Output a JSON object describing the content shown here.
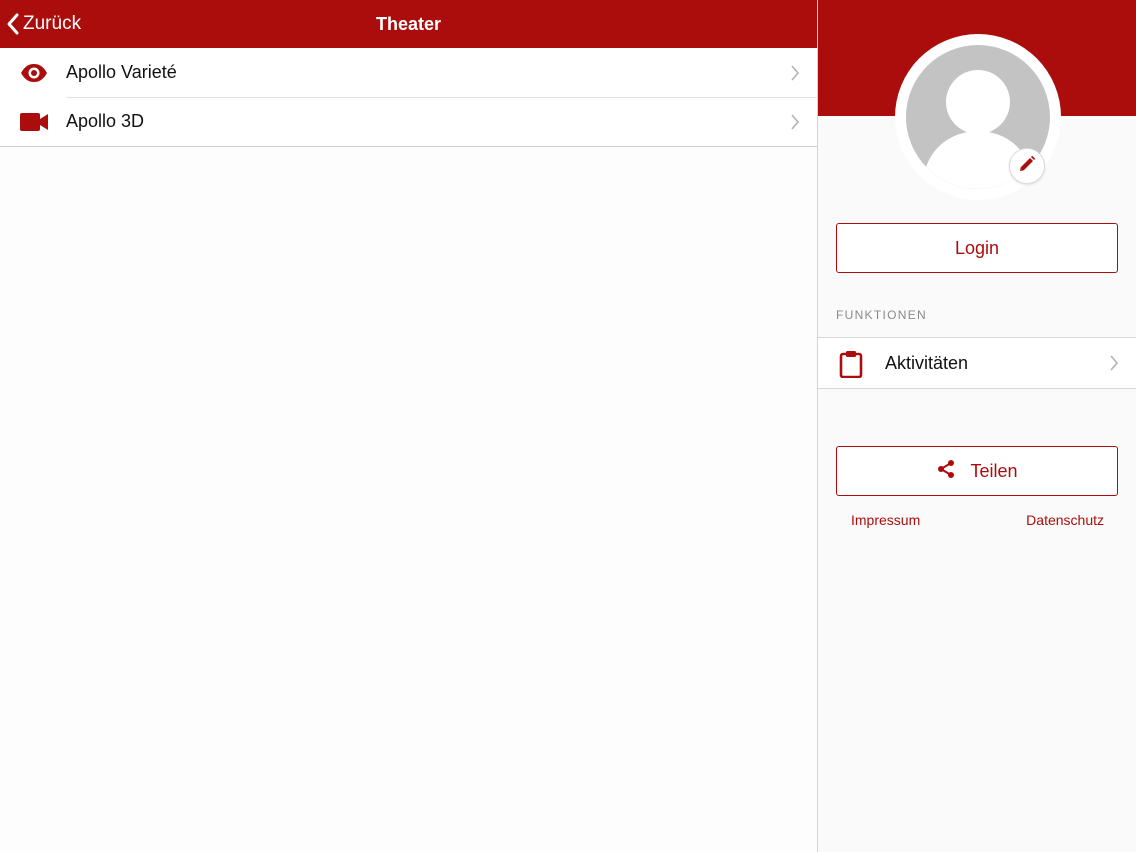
{
  "colors": {
    "accent": "#ab0c0c",
    "background": "#fdfdfd"
  },
  "navbar": {
    "back_label": "Zurück",
    "back_icon": "chevron-left-icon",
    "title": "Theater"
  },
  "list": {
    "items": [
      {
        "label": "Apollo Varieté",
        "icon": "eye-icon"
      },
      {
        "label": "Apollo 3D",
        "icon": "video-camera-icon"
      }
    ]
  },
  "profile": {
    "avatar": "user-placeholder-icon",
    "edit_icon": "pencil-icon",
    "login_label": "Login",
    "section_header": "FUNKTIONEN",
    "functions": [
      {
        "label": "Aktivitäten",
        "icon": "clipboard-icon"
      }
    ],
    "share_label": "Teilen",
    "share_icon": "share-icon",
    "links": {
      "impressum": "Impressum",
      "datenschutz": "Datenschutz"
    }
  }
}
